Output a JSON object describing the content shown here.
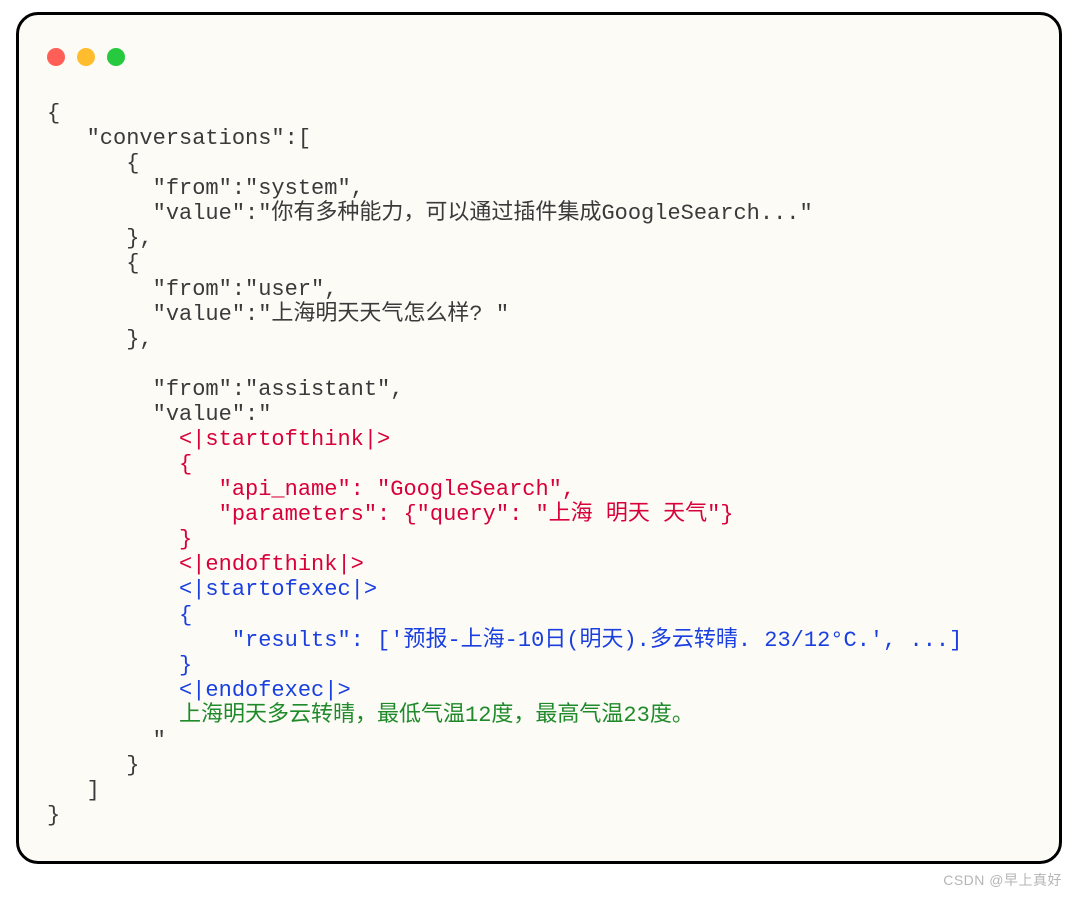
{
  "dots": {
    "red": "#ff5f56",
    "yellow": "#ffbd2e",
    "green": "#27c93f"
  },
  "code": {
    "line01": "{",
    "line02": "   \"conversations\":[",
    "line03": "      {",
    "line04": "        \"from\":\"system\",",
    "line05": "        \"value\":\"你有多种能力，可以通过插件集成GoogleSearch...\"",
    "line06": "      },",
    "line07": "      {",
    "line08": "        \"from\":\"user\",",
    "line09": "        \"value\":\"上海明天天气怎么样? \"",
    "line10": "      },",
    "line11": "",
    "line12": "        \"from\":\"assistant\",",
    "line13": "        \"value\":\"",
    "line14": "          <|startofthink|>",
    "line15": "          {",
    "line16": "             \"api_name\": \"GoogleSearch\",",
    "line17": "             \"parameters\": {\"query\": \"上海 明天 天气\"}",
    "line18": "          }",
    "line19": "          <|endofthink|>",
    "line20": "          <|startofexec|>",
    "line21": "          {",
    "line22": "              \"results\": ['预报-上海-10日(明天).多云转晴. 23/12°C.', ...]",
    "line23": "          }",
    "line24": "          <|endofexec|>",
    "line25": "          上海明天多云转晴，最低气温12度，最高气温23度。",
    "line26": "        \"",
    "line27": "      }",
    "line28": "   ]",
    "line29": "}"
  },
  "watermark": "CSDN @早上真好"
}
